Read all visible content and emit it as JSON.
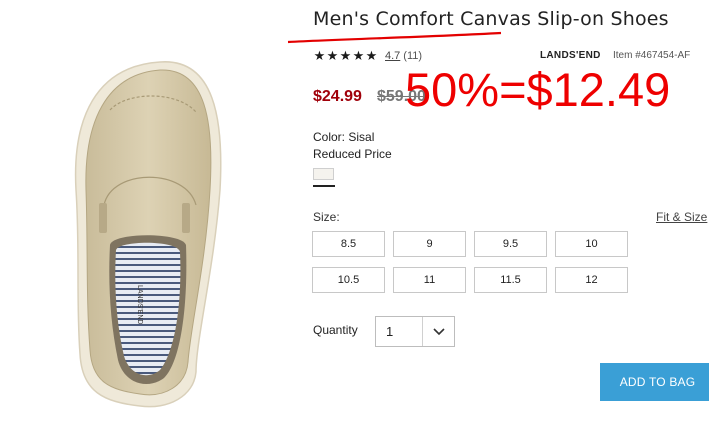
{
  "product": {
    "title": "Men's Comfort Canvas Slip-on Shoes",
    "rating_value": "4.7",
    "rating_count": "(11)",
    "stars": [
      "★",
      "★",
      "★",
      "★",
      "★"
    ],
    "brand": "LANDS'END",
    "item_number": "Item #467454-AF",
    "sale_price": "$24.99",
    "original_price": "$59.00"
  },
  "annotation": {
    "discount_text": "50%=$12.49",
    "color": "#ee0000"
  },
  "options": {
    "color_label": "Color: Sisal",
    "price_note": "Reduced Price",
    "size_label": "Size:",
    "fit_link": "Fit & Size",
    "sizes": [
      "8.5",
      "9",
      "9.5",
      "10",
      "10.5",
      "11",
      "11.5",
      "12"
    ]
  },
  "quantity": {
    "label": "Quantity",
    "value": "1"
  },
  "cart": {
    "add_label": "ADD TO BAG",
    "color": "#3a9fd6"
  },
  "image": {
    "insole_logo": "LANDS'END"
  }
}
